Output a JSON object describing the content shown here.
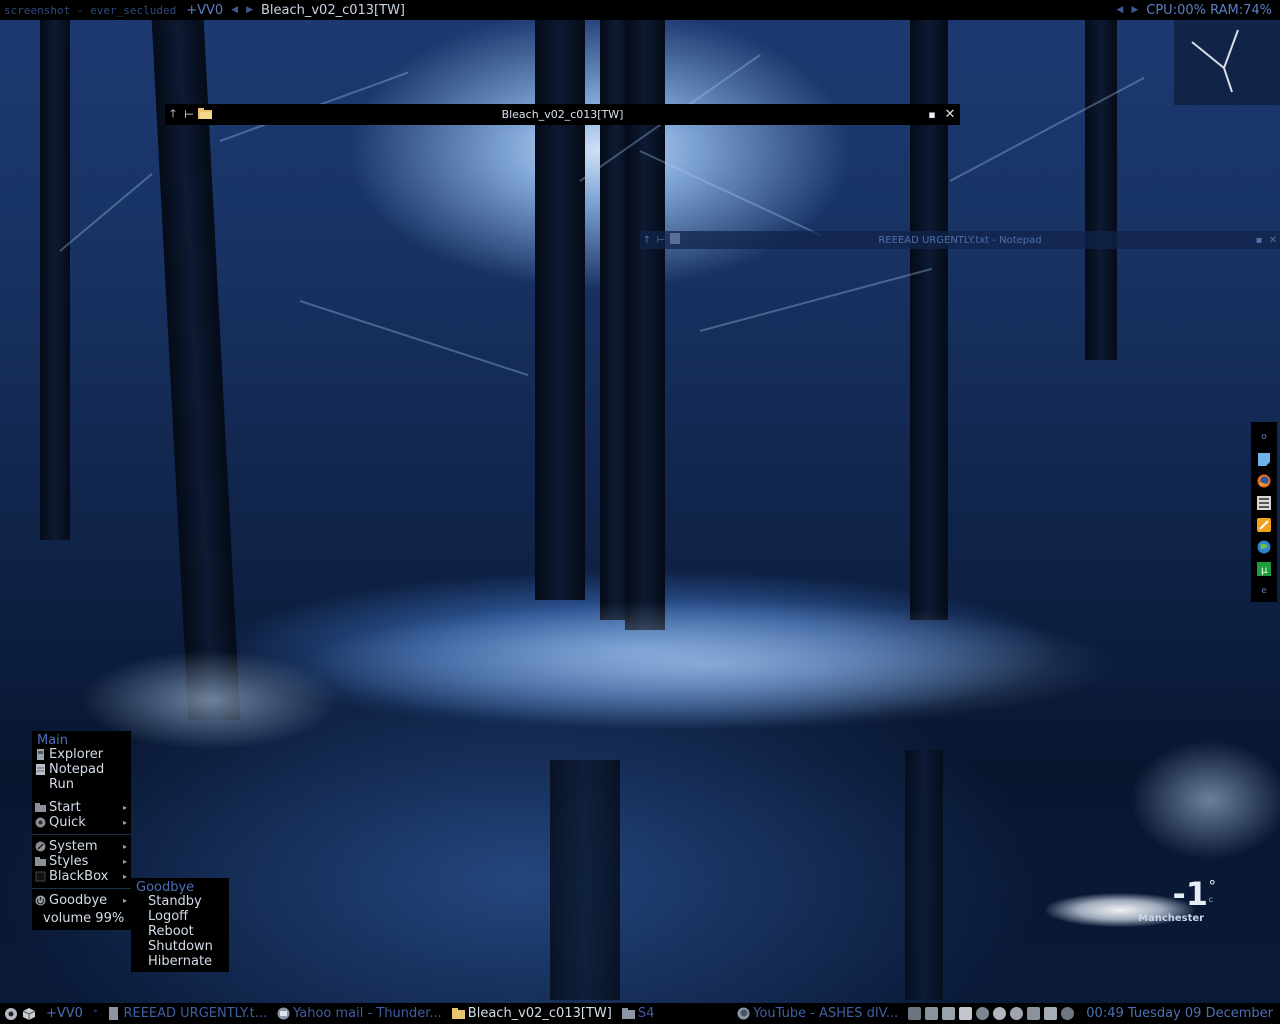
{
  "top_bar": {
    "label": "screenshot - ever_secluded",
    "workspace": "+VV0",
    "window_title": "Bleach_v02_c013[TW]",
    "stats": "CPU:00% RAM:74%"
  },
  "window_bleach": {
    "title": "Bleach_v02_c013[TW]"
  },
  "window_notepad": {
    "title": "REEEAD URGENTLY.txt - Notepad"
  },
  "dock": {
    "top_label": "o",
    "bottom_label": "e",
    "icons": [
      "note-icon",
      "firefox-icon",
      "media-icon",
      "pencil-icon",
      "globe-icon",
      "utorrent-icon"
    ]
  },
  "main_menu": {
    "title": "Main",
    "items": [
      "Explorer",
      "Notepad",
      "Run"
    ],
    "group2": [
      "Start",
      "Quick"
    ],
    "group3": [
      "System",
      "Styles",
      "BlackBox"
    ],
    "goodbye": "Goodbye",
    "volume": "volume 99%"
  },
  "goodbye_menu": {
    "title": "Goodbye",
    "items": [
      "Standby",
      "Logoff",
      "Reboot",
      "Shutdown",
      "Hibernate"
    ]
  },
  "weather": {
    "temperature": "-1",
    "degree": "°",
    "unit": "c",
    "city": "Manchester"
  },
  "taskbar": {
    "workspace": "+VV0",
    "separator": "°",
    "tasks": [
      {
        "label": "REEEAD URGENTLY.t...",
        "active": false
      },
      {
        "label": "Yahoo mail - Thunder...",
        "active": false
      },
      {
        "label": "Bleach_v02_c013[TW]",
        "active": true
      },
      {
        "label": "S4",
        "active": false
      },
      {
        "label": "YouTube - ASHES dIV...",
        "active": false
      }
    ],
    "clock": "00:49 Tuesday 09 December"
  },
  "colors": {
    "accent": "#4a6fb6",
    "bar_background": "#000000",
    "active_text": "#d6deec"
  }
}
